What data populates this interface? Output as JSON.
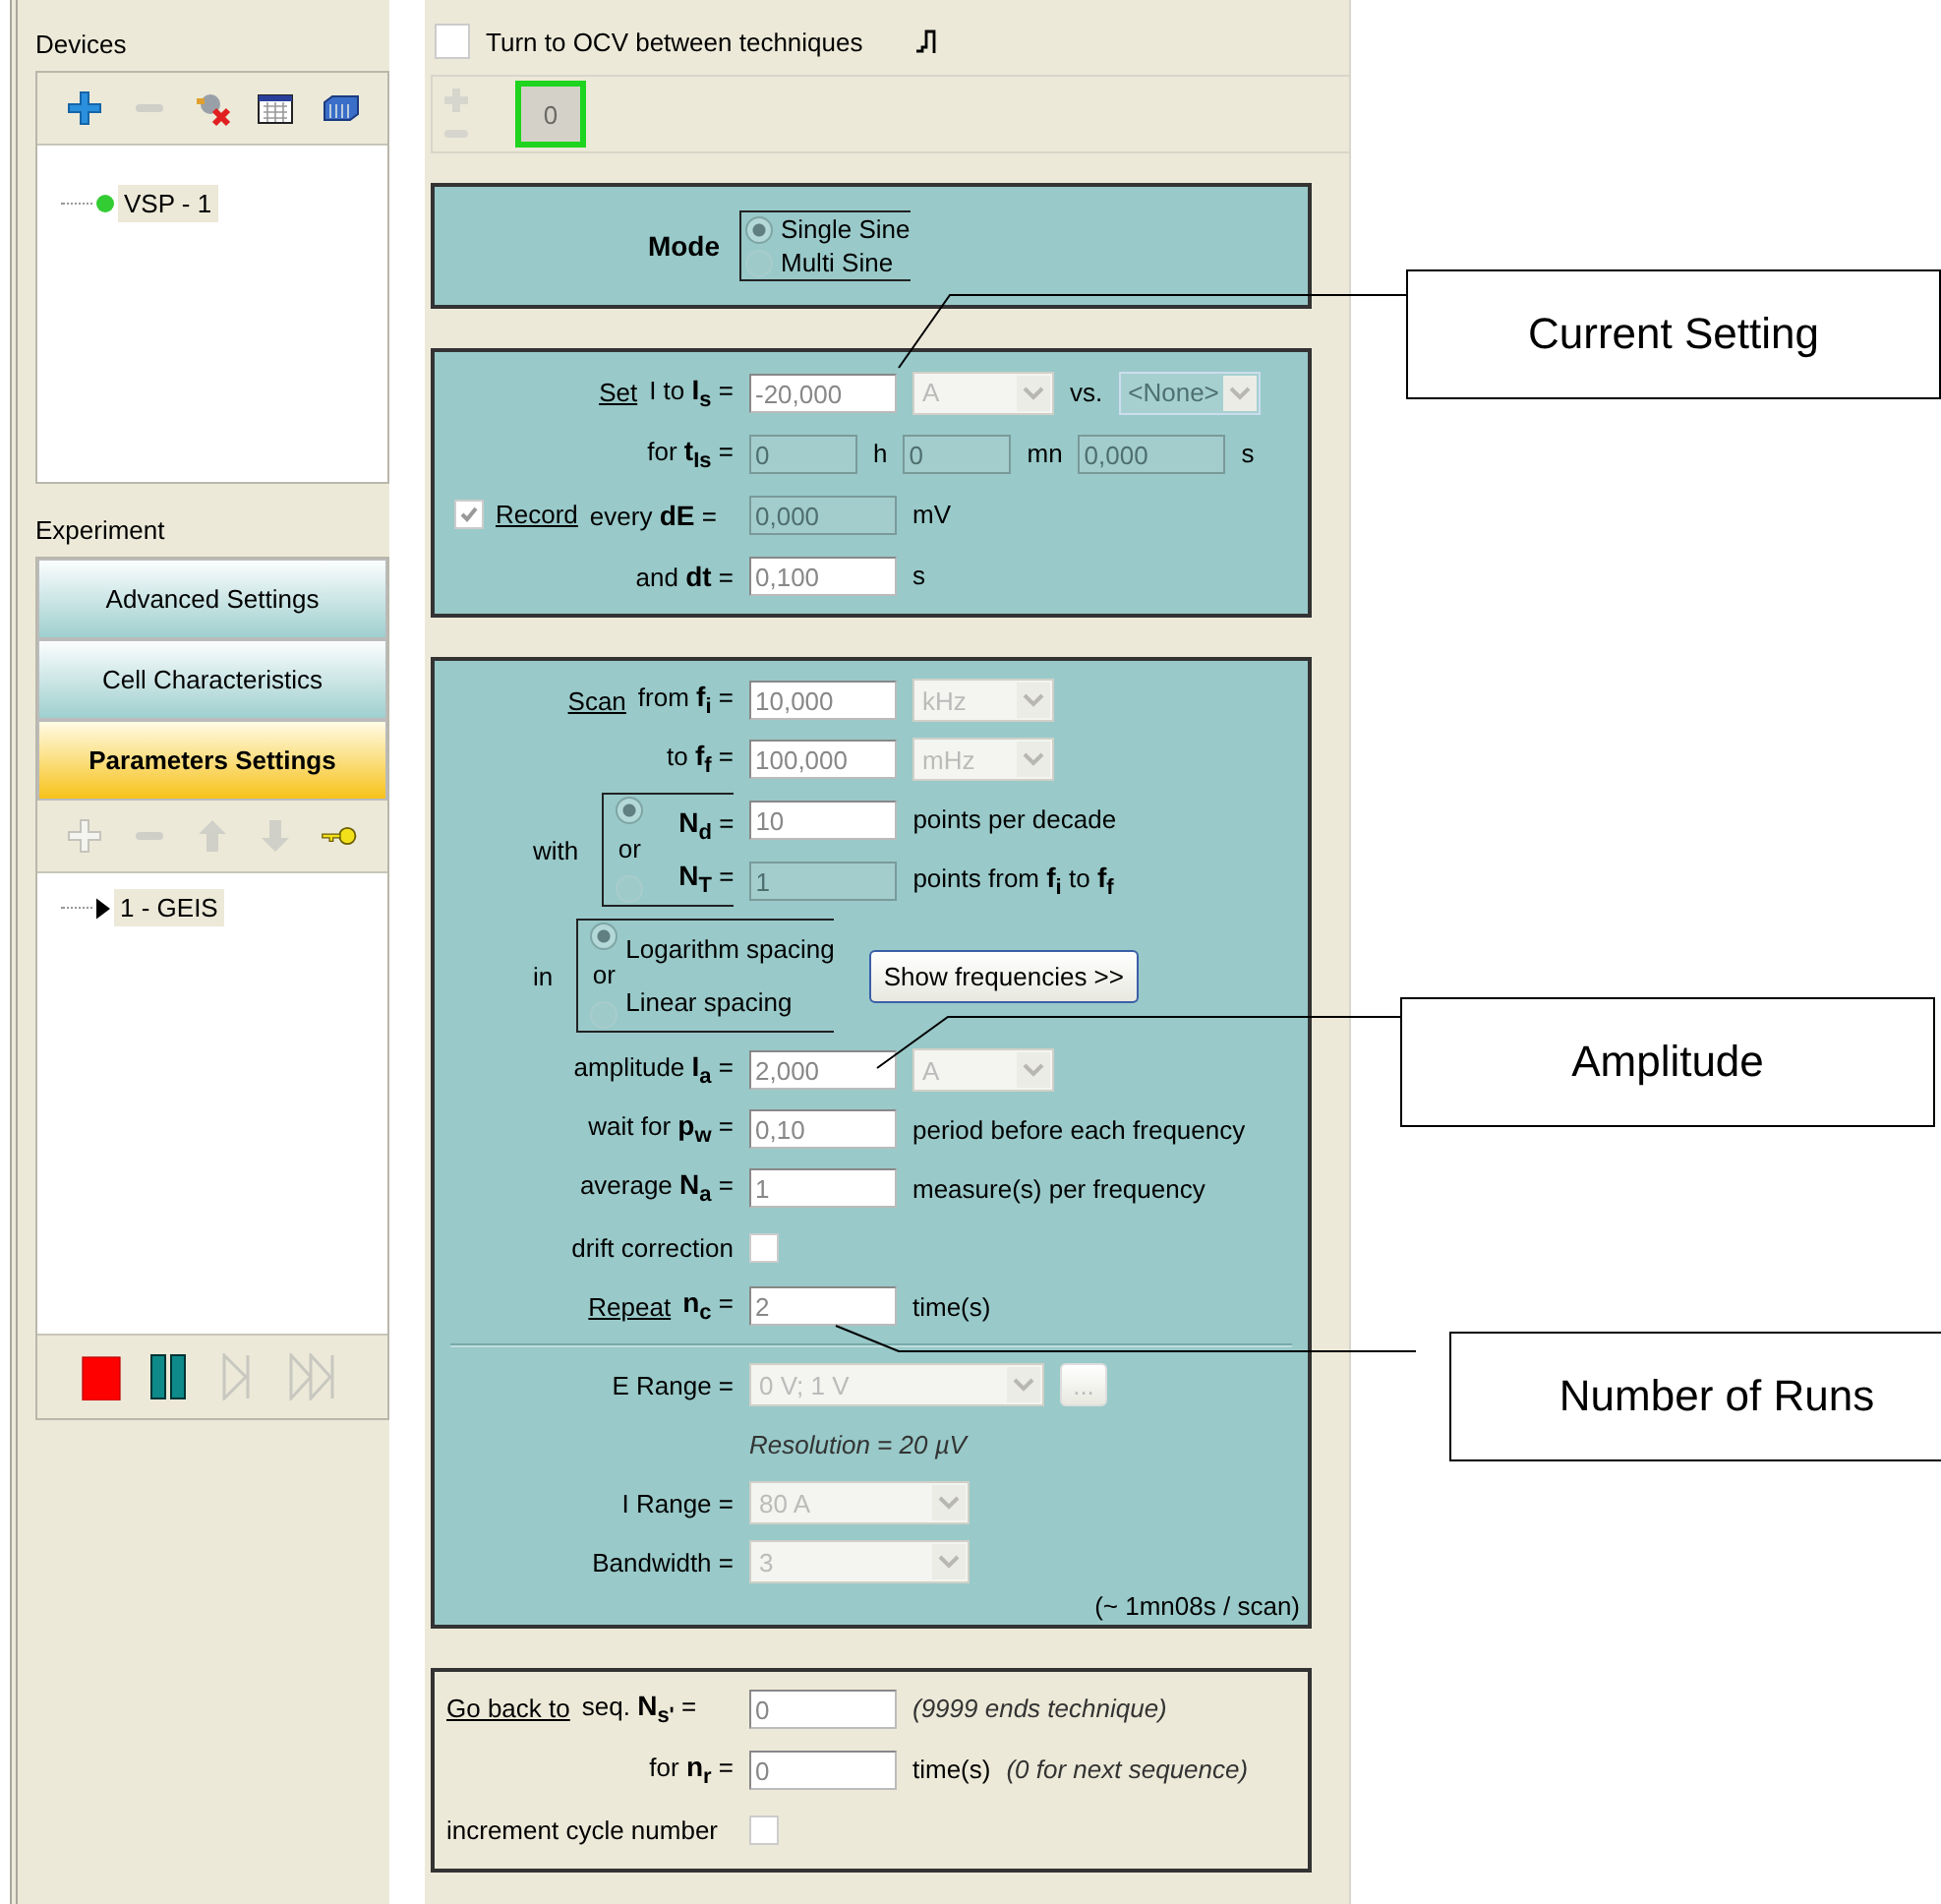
{
  "devices": {
    "title": "Devices",
    "tree": [
      {
        "label": "VSP - 1"
      }
    ]
  },
  "experiment": {
    "title": "Experiment",
    "tabs": [
      {
        "label": "Advanced Settings",
        "selected": false
      },
      {
        "label": "Cell Characteristics",
        "selected": false
      },
      {
        "label": "Parameters Settings",
        "selected": true
      }
    ],
    "tree": [
      {
        "label": "1 - GEIS"
      }
    ]
  },
  "ocv": {
    "label": "Turn to OCV between techniques",
    "checked": false
  },
  "sequence": {
    "tabs": [
      {
        "label": "0",
        "selected": true
      }
    ]
  },
  "mode": {
    "label": "Mode",
    "options": [
      {
        "label": "Single Sine",
        "selected": true
      },
      {
        "label": "Multi Sine",
        "selected": false
      }
    ]
  },
  "current_panel": {
    "rows": [
      {
        "kind": "row",
        "accel": "Set",
        "label": "I to **I**$_{s}$ =",
        "items": [
          {
            "kind": "field",
            "value": "-20,000",
            "disabled": false
          },
          {
            "kind": "select",
            "value": "A",
            "disabled": false
          },
          {
            "kind": "text",
            "text": "vs."
          },
          {
            "kind": "select",
            "value": "<None>",
            "disabled": true
          }
        ]
      },
      {
        "kind": "row",
        "label": "for **t**$_{Is}$ =",
        "items": [
          {
            "kind": "field",
            "value": "0",
            "disabled": true
          },
          {
            "kind": "text",
            "text": "h"
          },
          {
            "kind": "field",
            "value": "0",
            "disabled": true
          },
          {
            "kind": "text",
            "text": "mn"
          },
          {
            "kind": "field",
            "value": "0,000",
            "disabled": true
          },
          {
            "kind": "text",
            "text": "s"
          }
        ]
      },
      {
        "kind": "row",
        "check": {
          "checked": true
        },
        "accel": "Record",
        "label": "every **dE** =",
        "items": [
          {
            "kind": "field",
            "value": "0,000",
            "disabled": true
          },
          {
            "kind": "text",
            "text": "mV"
          }
        ]
      },
      {
        "kind": "row",
        "label": "and **dt** =",
        "items": [
          {
            "kind": "field",
            "value": "0,100",
            "disabled": false
          },
          {
            "kind": "text",
            "text": "s"
          }
        ]
      }
    ]
  },
  "scan_panel": {
    "rows": [
      {
        "kind": "row",
        "accel": "Scan",
        "label": "from **f**$_{i}$ =",
        "items": [
          {
            "kind": "field",
            "value": "10,000",
            "disabled": false
          },
          {
            "kind": "select",
            "value": "kHz",
            "disabled": false
          }
        ]
      },
      {
        "kind": "row",
        "label": "to **f**$_{f}$ =",
        "items": [
          {
            "kind": "field",
            "value": "100,000",
            "disabled": false
          },
          {
            "kind": "select",
            "value": "mHz",
            "disabled": false
          }
        ]
      },
      {
        "kind": "choice",
        "label": "with",
        "joiner": "or",
        "options": [
          {
            "selected": true,
            "label": "**N**$_{d}$ =",
            "items": [
              {
                "kind": "field",
                "value": "10",
                "disabled": false
              },
              {
                "kind": "text",
                "text": "points per decade"
              }
            ]
          },
          {
            "selected": false,
            "label": "**N**$_{T}$ =",
            "items": [
              {
                "kind": "field",
                "value": "1",
                "disabled": true
              },
              {
                "kind": "text",
                "text": "points from **f**$_{i}$ to **f**$_{f}$"
              }
            ]
          }
        ]
      },
      {
        "kind": "choice",
        "label": "in",
        "joiner": "or",
        "options": [
          {
            "selected": true,
            "label": "Logarithm spacing"
          },
          {
            "selected": false,
            "label": "Linear spacing"
          }
        ],
        "items": [
          {
            "kind": "button",
            "text": "Show frequencies >>"
          }
        ]
      },
      {
        "kind": "row",
        "label": "amplitude **I**$_{a}$ =",
        "items": [
          {
            "kind": "field",
            "value": "2,000",
            "disabled": false
          },
          {
            "kind": "select",
            "value": "A",
            "disabled": false
          }
        ]
      },
      {
        "kind": "row",
        "label": "wait for **p**$_{w}$ =",
        "items": [
          {
            "kind": "field",
            "value": "0,10",
            "disabled": false
          },
          {
            "kind": "text",
            "text": "period before each frequency"
          }
        ]
      },
      {
        "kind": "row",
        "label": "average **N**$_{a}$ =",
        "items": [
          {
            "kind": "field",
            "value": "1",
            "disabled": false
          },
          {
            "kind": "text",
            "text": "measure(s) per frequency"
          }
        ]
      },
      {
        "kind": "row",
        "label": "drift correction",
        "items": [
          {
            "kind": "check",
            "checked": false
          }
        ]
      },
      {
        "kind": "row",
        "accel": "Repeat",
        "label": "**n**$_{c}$ =",
        "items": [
          {
            "kind": "field",
            "value": "2",
            "disabled": false
          },
          {
            "kind": "text",
            "text": "time(s)"
          }
        ]
      },
      {
        "kind": "divider"
      },
      {
        "kind": "row",
        "label": "E Range =",
        "items": [
          {
            "kind": "select",
            "value": "0 V; 1 V",
            "disabled": false
          },
          {
            "kind": "button",
            "text": "..."
          }
        ]
      },
      {
        "kind": "note",
        "text": "Resolution = 20 µV"
      },
      {
        "kind": "row",
        "label": "I Range =",
        "items": [
          {
            "kind": "select",
            "value": "80 A",
            "disabled": false
          }
        ]
      },
      {
        "kind": "row",
        "label": "Bandwidth =",
        "items": [
          {
            "kind": "select",
            "value": "3",
            "disabled": false
          }
        ]
      },
      {
        "kind": "footer",
        "text": "(~ 1mn08s / scan)"
      }
    ]
  },
  "goback_panel": {
    "rows": [
      {
        "kind": "row",
        "accel": "Go back to",
        "label": "seq. **N**$_{s'}$ =",
        "items": [
          {
            "kind": "field",
            "value": "0",
            "disabled": false
          },
          {
            "kind": "note",
            "text": "(9999 ends technique)"
          }
        ]
      },
      {
        "kind": "row",
        "label": "for **n**$_{r}$ =",
        "items": [
          {
            "kind": "field",
            "value": "0",
            "disabled": false
          },
          {
            "kind": "text",
            "text": "time(s)"
          },
          {
            "kind": "note",
            "text": "(0 for next sequence)"
          }
        ]
      },
      {
        "kind": "row",
        "label": "increment cycle number",
        "items": [
          {
            "kind": "check",
            "checked": false
          }
        ]
      }
    ]
  },
  "callouts": [
    {
      "label": "Current Setting"
    },
    {
      "label": "Amplitude"
    },
    {
      "label": "Number of Runs"
    }
  ]
}
